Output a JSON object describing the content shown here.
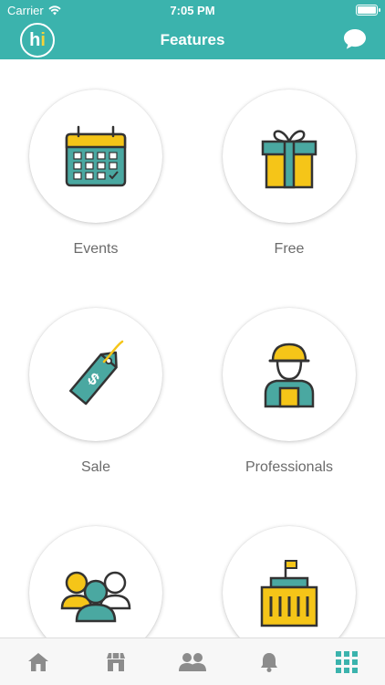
{
  "status_bar": {
    "carrier": "Carrier",
    "time": "7:05 PM"
  },
  "nav": {
    "logo": {
      "h": "h",
      "i": "i"
    },
    "title": "Features"
  },
  "features": [
    {
      "label": "Events",
      "icon": "calendar-icon"
    },
    {
      "label": "Free",
      "icon": "gift-icon"
    },
    {
      "label": "Sale",
      "icon": "price-tag-icon"
    },
    {
      "label": "Professionals",
      "icon": "worker-icon"
    },
    {
      "label": "",
      "icon": "group-icon"
    },
    {
      "label": "",
      "icon": "building-icon"
    }
  ],
  "tabs": [
    {
      "icon": "home-icon",
      "active": false
    },
    {
      "icon": "store-icon",
      "active": false
    },
    {
      "icon": "people-icon",
      "active": false
    },
    {
      "icon": "bell-icon",
      "active": false
    },
    {
      "icon": "grid-icon",
      "active": true
    }
  ],
  "colors": {
    "accent": "#3bb3ad",
    "yellow": "#f5c518",
    "teal": "#4aa8a1",
    "dark": "#3a3a3a",
    "inactive_tab": "#8c8c8c"
  }
}
